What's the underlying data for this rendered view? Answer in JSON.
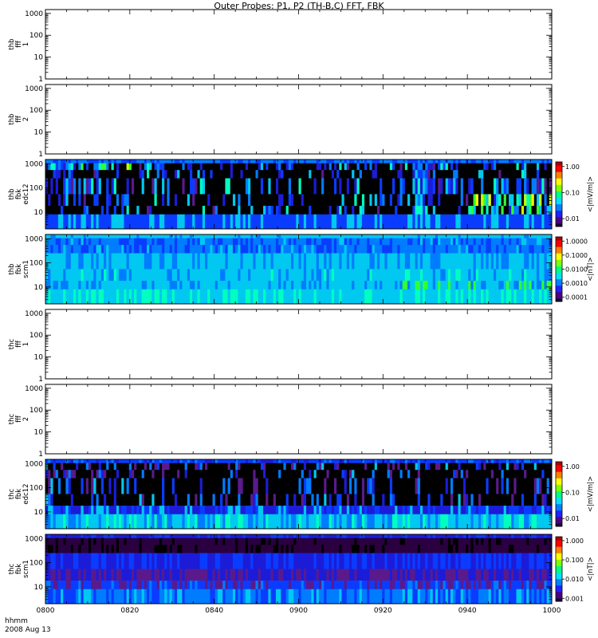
{
  "title": "Outer Probes: P1, P2 (TH-B,C) FFT, FBK",
  "footer": {
    "format_label": "hhmm",
    "date_label": "2008 Aug 13"
  },
  "chart_data": [
    {
      "type": "heatmap",
      "panel": 1,
      "ylabel_lines": [
        "thb",
        "fff",
        "1"
      ],
      "y_scale": "log",
      "ylim": [
        1,
        1500
      ],
      "y_ticks": [
        "1",
        "10",
        "100",
        "1000"
      ],
      "has_data": false,
      "colorbar": null
    },
    {
      "type": "heatmap",
      "panel": 2,
      "ylabel_lines": [
        "thb",
        "fff",
        "2"
      ],
      "y_scale": "log",
      "ylim": [
        1,
        1500
      ],
      "y_ticks": [
        "1",
        "10",
        "100",
        "1000"
      ],
      "has_data": false,
      "colorbar": null
    },
    {
      "type": "heatmap",
      "panel": 3,
      "ylabel_lines": [
        "thb",
        "fbk",
        "edc12"
      ],
      "y_scale": "log",
      "ylim": [
        2,
        1500
      ],
      "y_ticks": [
        "10",
        "100",
        "1000"
      ],
      "has_data": true,
      "pattern": "edc_b",
      "colorbar": {
        "label": "<|mV/m|>",
        "ticks": [
          "0.01",
          "0.10",
          "1.00"
        ],
        "scale": "log",
        "range": [
          0.005,
          1.5
        ]
      }
    },
    {
      "type": "heatmap",
      "panel": 4,
      "ylabel_lines": [
        "thb",
        "fbk",
        "scm1"
      ],
      "y_scale": "log",
      "ylim": [
        2,
        1500
      ],
      "y_ticks": [
        "10",
        "100",
        "1000"
      ],
      "has_data": true,
      "pattern": "scm_b",
      "colorbar": {
        "label": "<|nT|>",
        "ticks": [
          "0.0001",
          "0.0010",
          "0.0100",
          "0.1000",
          "1.0000"
        ],
        "scale": "log",
        "range": [
          5e-05,
          2.0
        ]
      }
    },
    {
      "type": "heatmap",
      "panel": 5,
      "ylabel_lines": [
        "thc",
        "fff",
        "1"
      ],
      "y_scale": "log",
      "ylim": [
        1,
        1500
      ],
      "y_ticks": [
        "1",
        "10",
        "100",
        "1000"
      ],
      "has_data": false,
      "colorbar": null
    },
    {
      "type": "heatmap",
      "panel": 6,
      "ylabel_lines": [
        "thc",
        "fff",
        "2"
      ],
      "y_scale": "log",
      "ylim": [
        1,
        1500
      ],
      "y_ticks": [
        "1",
        "10",
        "100",
        "1000"
      ],
      "has_data": false,
      "colorbar": null
    },
    {
      "type": "heatmap",
      "panel": 7,
      "ylabel_lines": [
        "thc",
        "fbk",
        "edc12"
      ],
      "y_scale": "log",
      "ylim": [
        2,
        1500
      ],
      "y_ticks": [
        "10",
        "100",
        "1000"
      ],
      "has_data": true,
      "pattern": "edc_c",
      "colorbar": {
        "label": "<|mV/m|>",
        "ticks": [
          "0.01",
          "0.10",
          "1.00"
        ],
        "scale": "log",
        "range": [
          0.005,
          1.5
        ]
      }
    },
    {
      "type": "heatmap",
      "panel": 8,
      "ylabel_lines": [
        "thc",
        "fbk",
        "scm1"
      ],
      "y_scale": "log",
      "ylim": [
        2,
        1500
      ],
      "y_ticks": [
        "10",
        "100",
        "1000"
      ],
      "has_data": true,
      "pattern": "scm_c",
      "colorbar": {
        "label": "<|nT|>",
        "ticks": [
          "0.001",
          "0.010",
          "0.100",
          "1.000"
        ],
        "scale": "log",
        "range": [
          0.0007,
          1.6
        ]
      }
    }
  ],
  "x_axis": {
    "type": "time",
    "range": [
      "0800",
      "1000"
    ],
    "tick_labels": [
      "0800",
      "0820",
      "0840",
      "0900",
      "0920",
      "0940",
      "1000"
    ]
  }
}
